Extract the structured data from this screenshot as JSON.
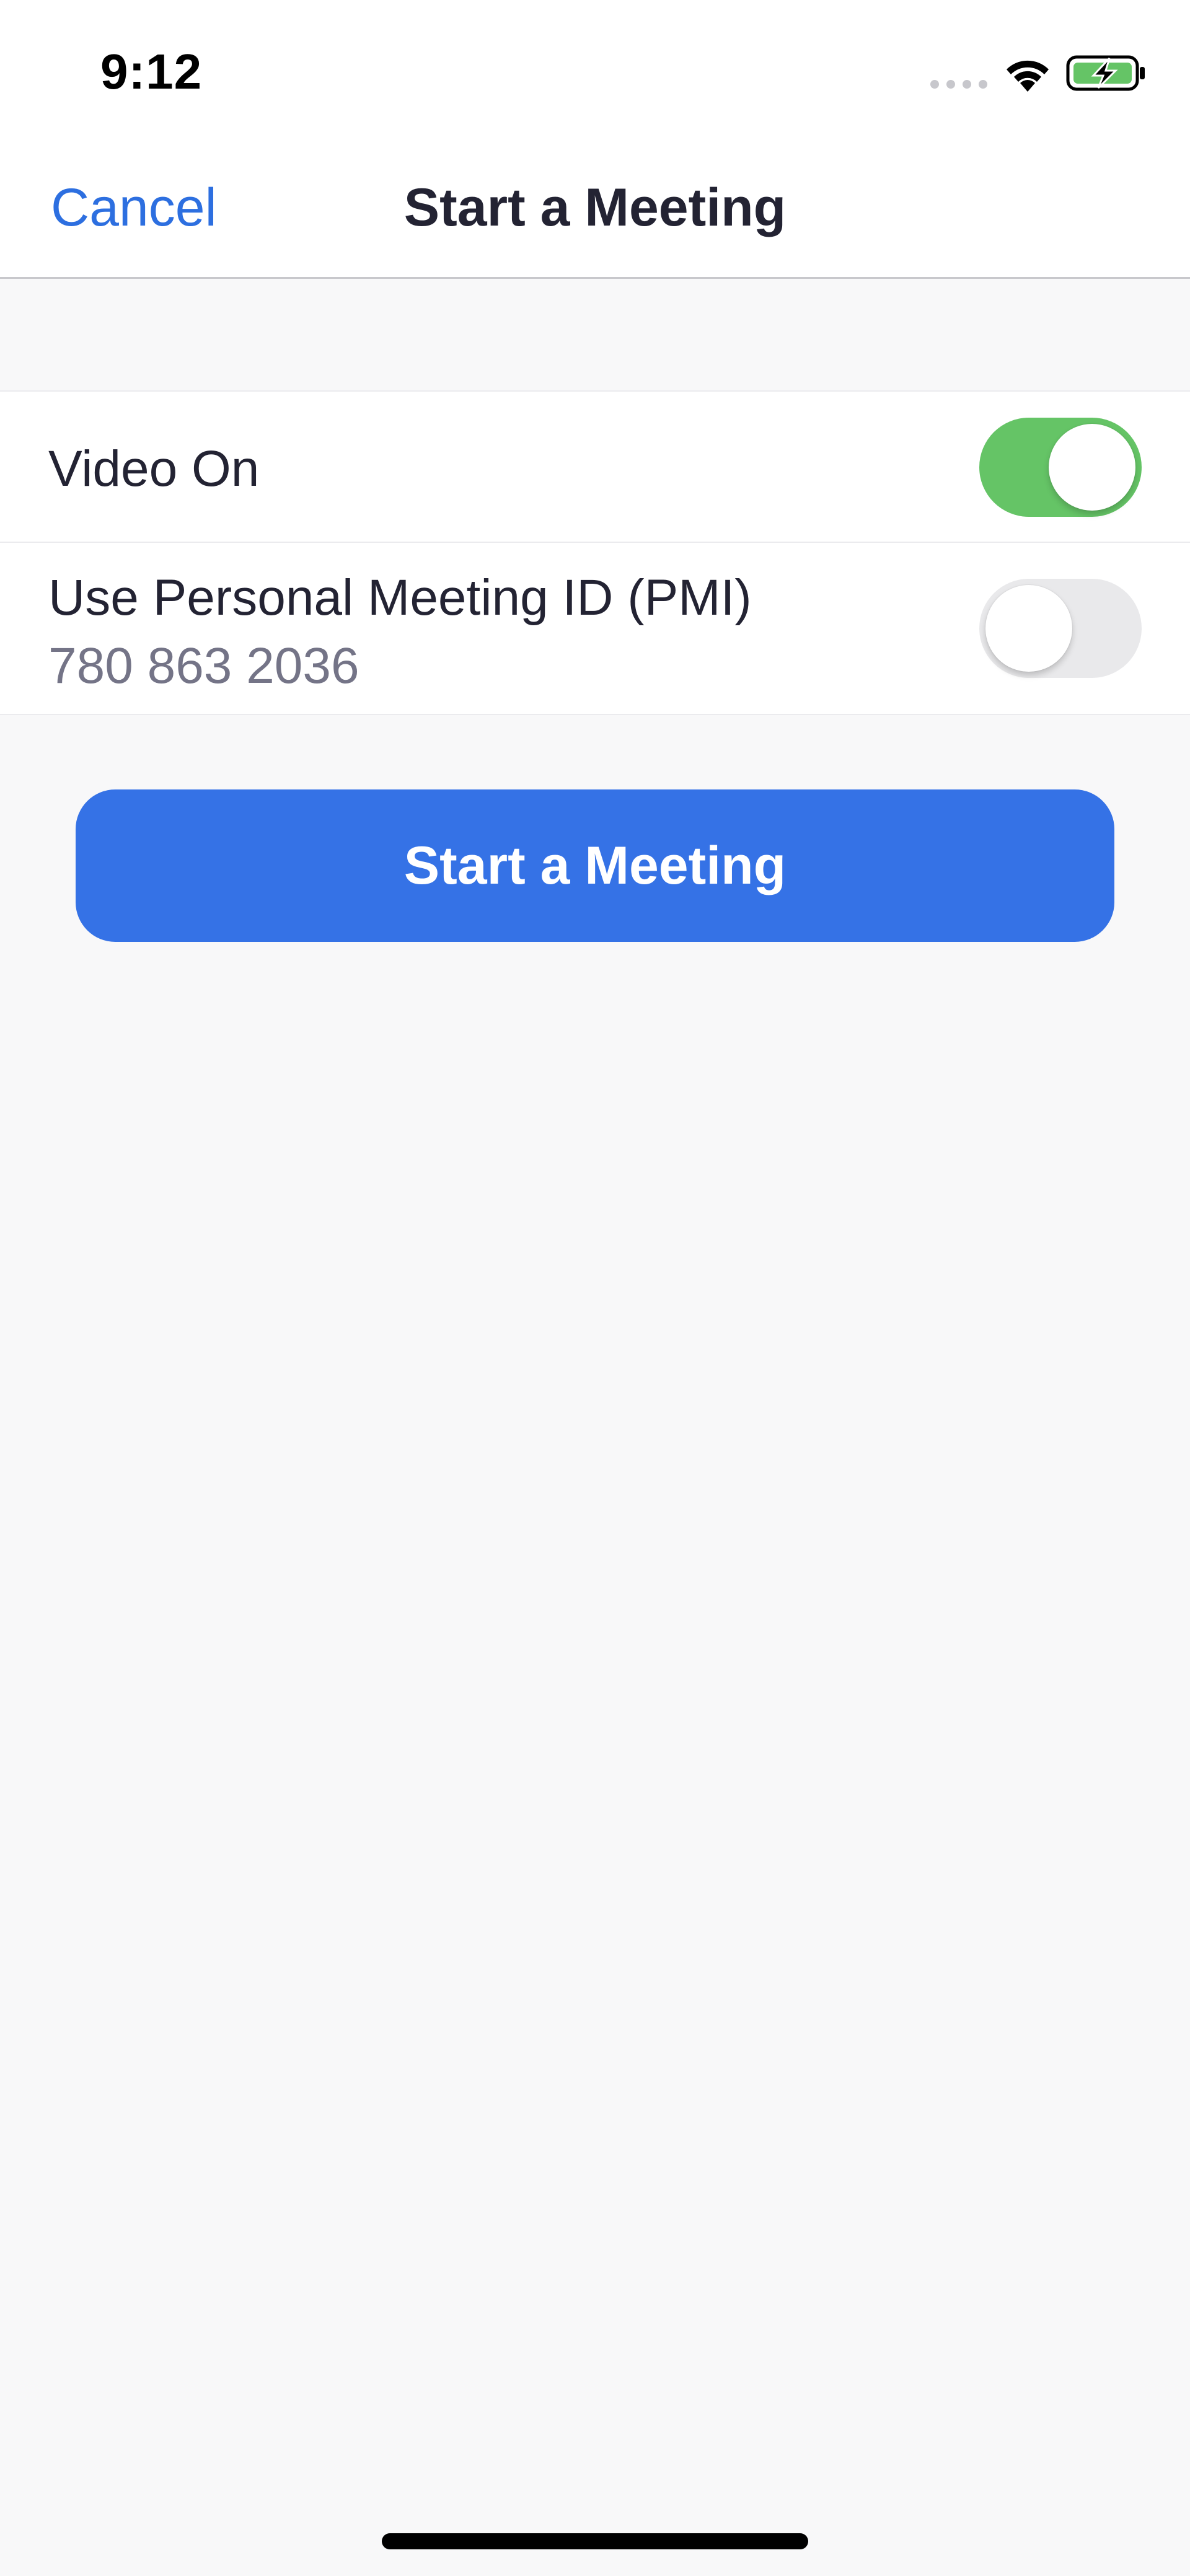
{
  "status_bar": {
    "time": "9:12",
    "icons": [
      "signal-dots-icon",
      "wifi-icon",
      "battery-charging-icon"
    ],
    "battery_color": "#65C466"
  },
  "nav": {
    "cancel_label": "Cancel",
    "title": "Start a Meeting"
  },
  "settings": {
    "video_on": {
      "label": "Video On",
      "enabled": true
    },
    "pmi": {
      "label": "Use Personal Meeting ID (PMI)",
      "meeting_id": "780 863 2036",
      "enabled": false
    }
  },
  "actions": {
    "start_label": "Start a Meeting"
  },
  "colors": {
    "accent": "#2D6FE0",
    "primary_button": "#3572E6",
    "toggle_on": "#65C466",
    "toggle_off": "#E9E9EB",
    "background": "#F8F8F9"
  }
}
